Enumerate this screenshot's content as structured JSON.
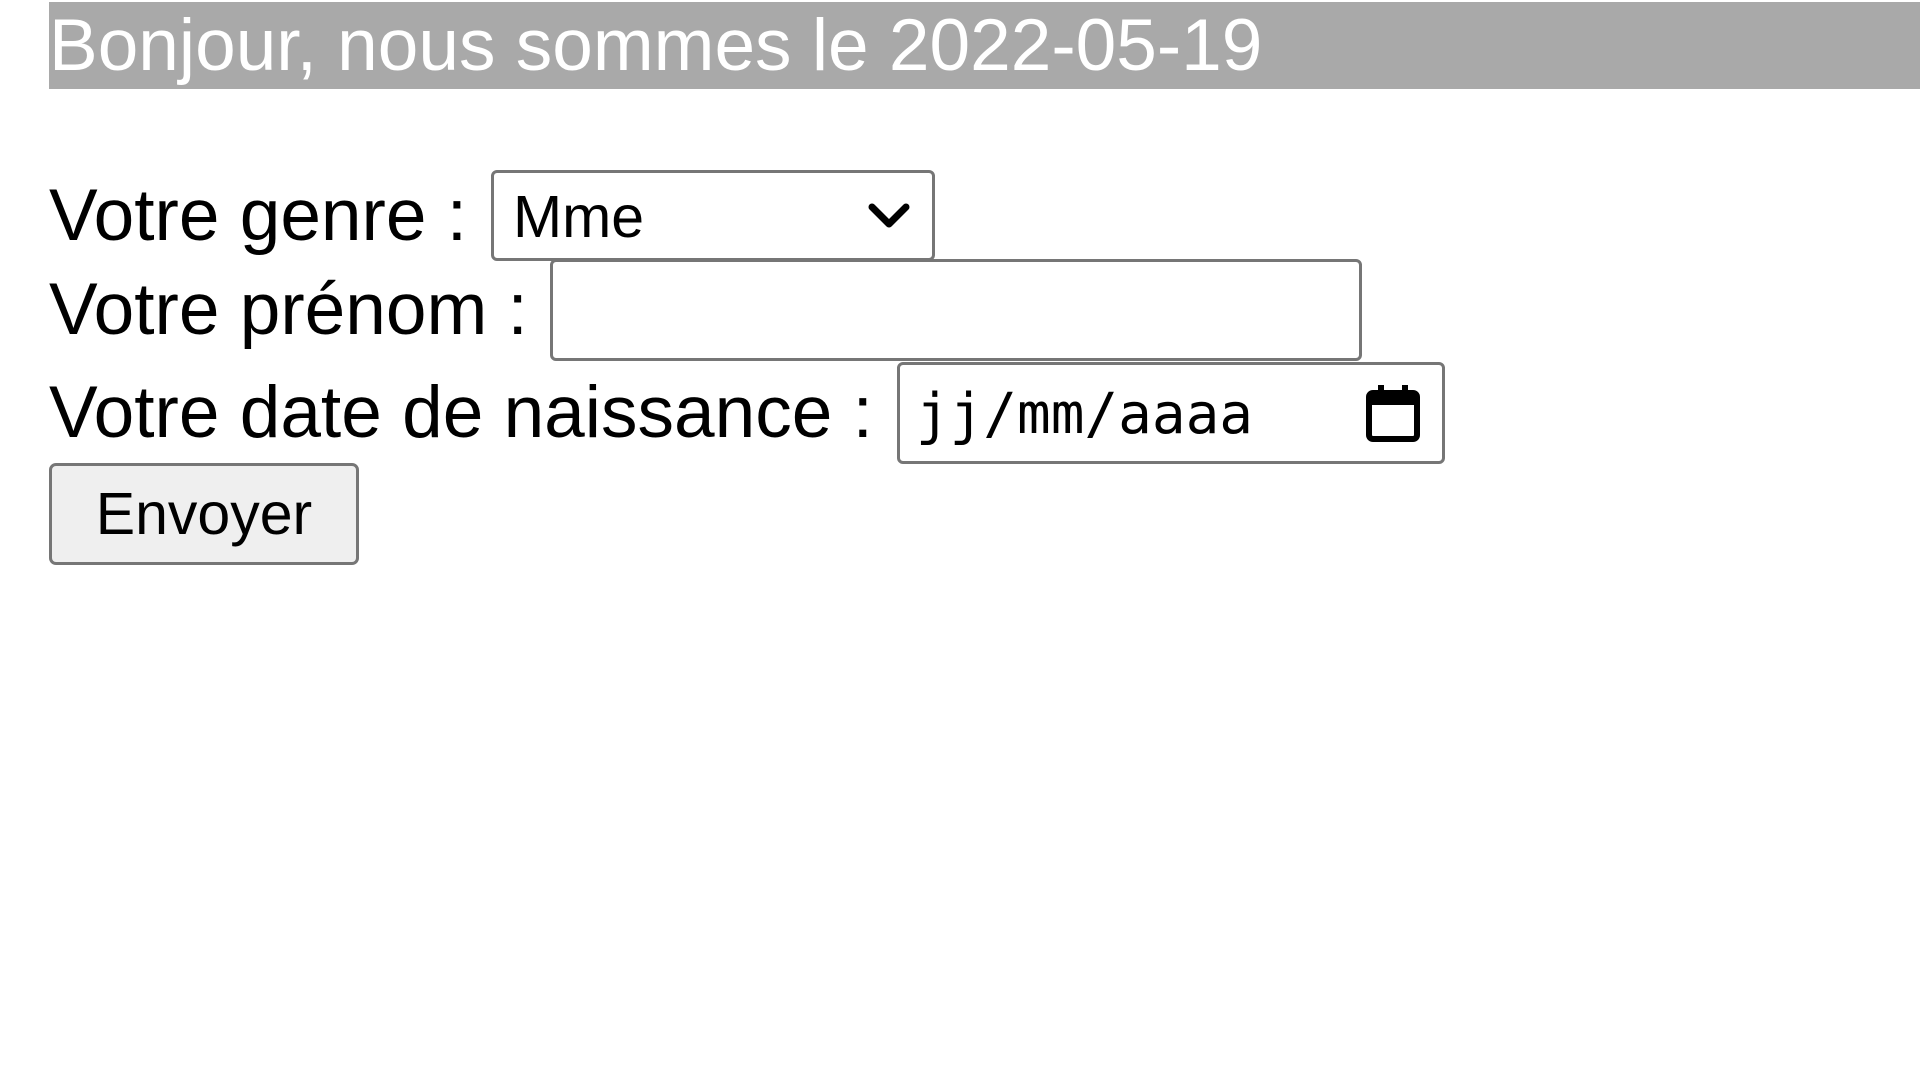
{
  "banner": {
    "text": "Bonjour, nous sommes le 2022-05-19",
    "background_color": "#a9a9a9",
    "text_color": "#ffffff"
  },
  "form": {
    "genre": {
      "label": "Votre genre :",
      "selected_value": "Mme",
      "icon": "chevron-down-icon"
    },
    "prenom": {
      "label": "Votre prénom :",
      "value": ""
    },
    "date_naissance": {
      "label": "Votre date de naissance :",
      "placeholder": "jj/mm/aaaa",
      "icon": "calendar-icon"
    },
    "submit_label": "Envoyer"
  }
}
